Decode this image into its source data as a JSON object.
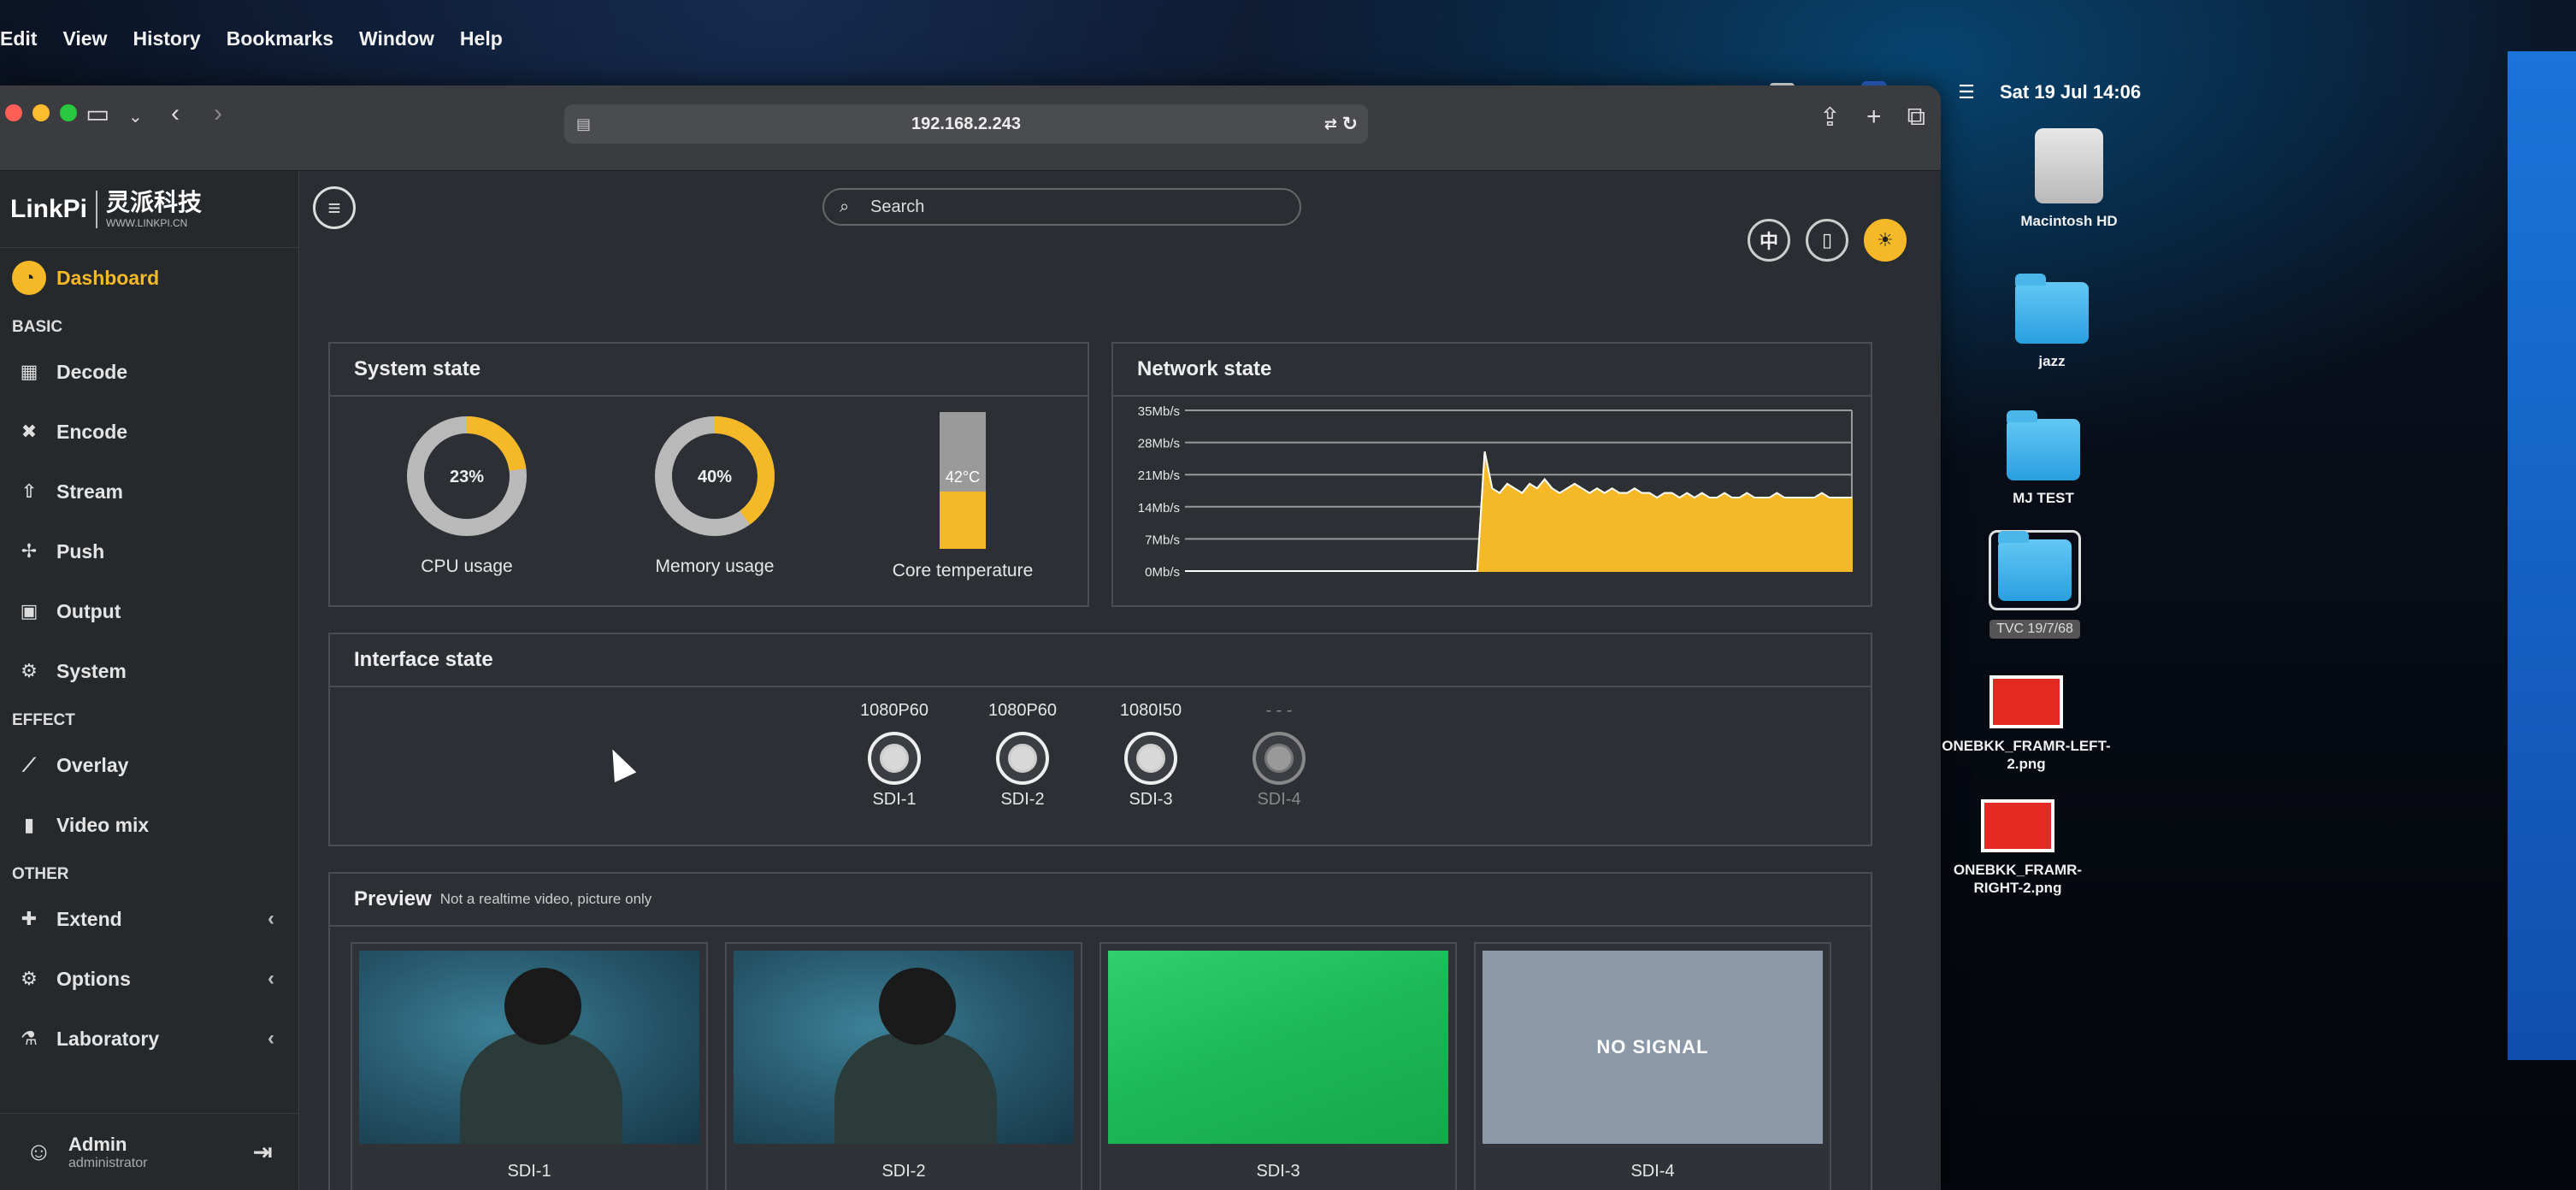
{
  "menubar": {
    "items": [
      "Edit",
      "View",
      "History",
      "Bookmarks",
      "Window",
      "Help"
    ],
    "status": {
      "input_badge": "A",
      "datetime": "Sat 19 Jul 14:06"
    }
  },
  "browser": {
    "url": "192.168.2.243"
  },
  "sidebar": {
    "brand": "LinkPi",
    "brand_cn": "灵派科技",
    "brand_site": "WWW.LINKPI.CN",
    "active_item": "Dashboard",
    "groups": {
      "basic": "BASIC",
      "effect": "EFFECT",
      "other": "OTHER"
    },
    "items": {
      "dashboard": "Dashboard",
      "decode": "Decode",
      "encode": "Encode",
      "stream": "Stream",
      "push": "Push",
      "output": "Output",
      "system": "System",
      "overlay": "Overlay",
      "videomix": "Video mix",
      "extend": "Extend",
      "options": "Options",
      "laboratory": "Laboratory"
    },
    "user": {
      "name": "Admin",
      "role": "administrator"
    }
  },
  "header": {
    "search_placeholder": "Search",
    "lang_label": "中"
  },
  "system_state": {
    "title": "System state",
    "cpu": {
      "value": 23,
      "label": "CPU usage",
      "text": "23%"
    },
    "memory": {
      "value": 40,
      "label": "Memory usage",
      "text": "40%"
    },
    "temperature": {
      "value": 42,
      "text": "42°C",
      "label": "Core temperature"
    }
  },
  "network_state": {
    "title": "Network state"
  },
  "chart_data": {
    "type": "area",
    "title": "Network state",
    "yticks": [
      "35Mb/s",
      "28Mb/s",
      "21Mb/s",
      "14Mb/s",
      "7Mb/s",
      "0Mb/s"
    ],
    "ylim": [
      0,
      35
    ],
    "series": [
      {
        "values": [
          0,
          0,
          0,
          0,
          0,
          0,
          0,
          0,
          0,
          0,
          0,
          0,
          0,
          0,
          0,
          0,
          0,
          0,
          0,
          0,
          0,
          0,
          0,
          0,
          0,
          0,
          0,
          0,
          0,
          0,
          0,
          0,
          0,
          0,
          0,
          0,
          0,
          0,
          0,
          0,
          26,
          18,
          17,
          19,
          18,
          17,
          19,
          18,
          20,
          18,
          17,
          18,
          19,
          18,
          17,
          18,
          17,
          18,
          17,
          17,
          18,
          17,
          17,
          16,
          17,
          17,
          16,
          17,
          16,
          17,
          16,
          16,
          17,
          16,
          16,
          17,
          16,
          16,
          16,
          17,
          16,
          16,
          16,
          16,
          16,
          17,
          16,
          16,
          16,
          16
        ]
      }
    ],
    "colors": {
      "fill": "#f5b928",
      "grid": "#9a9a9a"
    },
    "grid": true
  },
  "interface_state": {
    "title": "Interface state",
    "ports": [
      {
        "format": "1080P60",
        "name": "SDI-1",
        "active": true
      },
      {
        "format": "1080P60",
        "name": "SDI-2",
        "active": true
      },
      {
        "format": "1080I50",
        "name": "SDI-3",
        "active": true
      },
      {
        "format": "- - -",
        "name": "SDI-4",
        "active": false
      }
    ]
  },
  "preview": {
    "title": "Preview",
    "subtitle": "Not a realtime video, picture only",
    "tiles": [
      {
        "name": "SDI-1",
        "kind": "video"
      },
      {
        "name": "SDI-2",
        "kind": "video"
      },
      {
        "name": "SDI-3",
        "kind": "green"
      },
      {
        "name": "SDI-4",
        "kind": "nosignal",
        "message": "NO SIGNAL"
      }
    ]
  },
  "desktop": {
    "icons": [
      {
        "label": "Macintosh HD"
      },
      {
        "label": "jazz"
      },
      {
        "label": "MJ TEST"
      },
      {
        "label": "TVC 19/7/68"
      },
      {
        "label": "ONEBKK_FRAMR-LEFT-2.png"
      },
      {
        "label": "ONEBKK_FRAMR-RIGHT-2.png"
      }
    ]
  },
  "colors": {
    "accent": "#f5b928",
    "panel_bg": "#2c2f33",
    "window_bg": "#2a2d31"
  }
}
